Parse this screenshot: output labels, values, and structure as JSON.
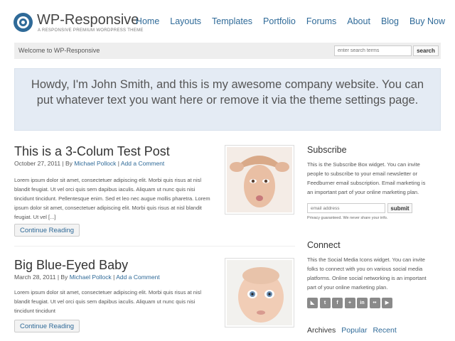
{
  "header": {
    "site_title": "WP-Responsive",
    "tagline": "A RESPONSIVE PREMIUM WORDPRESS THEME",
    "logo_icon": "circular-logo-icon"
  },
  "nav": {
    "items": [
      "Home",
      "Layouts",
      "Templates",
      "Portfolio",
      "Forums",
      "About",
      "Blog",
      "Buy Now"
    ]
  },
  "topbar": {
    "welcome": "Welcome to WP-Responsive",
    "search_placeholder": "enter search terms",
    "search_label": "search"
  },
  "hero": {
    "text": "Howdy, I'm John Smith, and this is my awesome company website. You can put whatever text you want here or remove it via the theme settings page."
  },
  "posts": [
    {
      "title": "This is a 3-Colum Test Post",
      "date": "October 27, 2011",
      "author": "Michael Pollock",
      "comment_link": "Add a Comment",
      "excerpt": "Lorem ipsum dolor sit amet, consectetuer adipiscing elit. Morbi quis risus at nisl blandit feugiat. Ut vel orci quis sem dapibus iaculis. Aliquam ut nunc quis nisi tincidunt tincidunt. Pellentesque enim. Sed et leo nec augue mollis pharetra. Lorem ipsum dolor sit amet, consectetuer adipiscing elit. Morbi quis risus at nisl blandit feugiat. Ut vel [...]",
      "read_more": "Continue Reading"
    },
    {
      "title": "Big Blue-Eyed Baby",
      "date": "March 28, 2011",
      "author": "Michael Pollock",
      "comment_link": "Add a Comment",
      "excerpt": "Lorem ipsum dolor sit amet, consectetuer adipiscing elit. Morbi quis risus at nisl blandit feugiat. Ut vel orci quis sem dapibus iaculis. Aliquam ut nunc quis nisi tincidunt tincidunt",
      "read_more": "Continue Reading"
    }
  ],
  "meta_by": "| By",
  "meta_sep": "|",
  "sidebar": {
    "subscribe": {
      "title": "Subscribe",
      "text": "This is the Subscribe Box widget. You can invite people to subscribe to your email newsletter or Feedburner email subscription. Email marketing is an important part of your online marketing plan.",
      "email_placeholder": "email address",
      "submit": "submit",
      "privacy": "Privacy guaranteed. We never share your info."
    },
    "connect": {
      "title": "Connect",
      "text": "This the Social Media Icons widget. You can invite folks to connect with you on various social media platforms. Online social networking is an important part of your online marketing plan.",
      "icons": [
        "rss-icon",
        "twitter-icon",
        "facebook-icon",
        "delicious-icon",
        "linkedin-icon",
        "flickr-icon",
        "youtube-icon"
      ],
      "icon_glyphs": [
        "◣",
        "t",
        "f",
        "+",
        "in",
        "••",
        "▶"
      ]
    },
    "tabs": [
      "Archives",
      "Popular",
      "Recent"
    ]
  },
  "colors": {
    "accent": "#2f6a98",
    "hero_bg": "#e4ebf4",
    "topbar_bg": "#eeeeee"
  }
}
